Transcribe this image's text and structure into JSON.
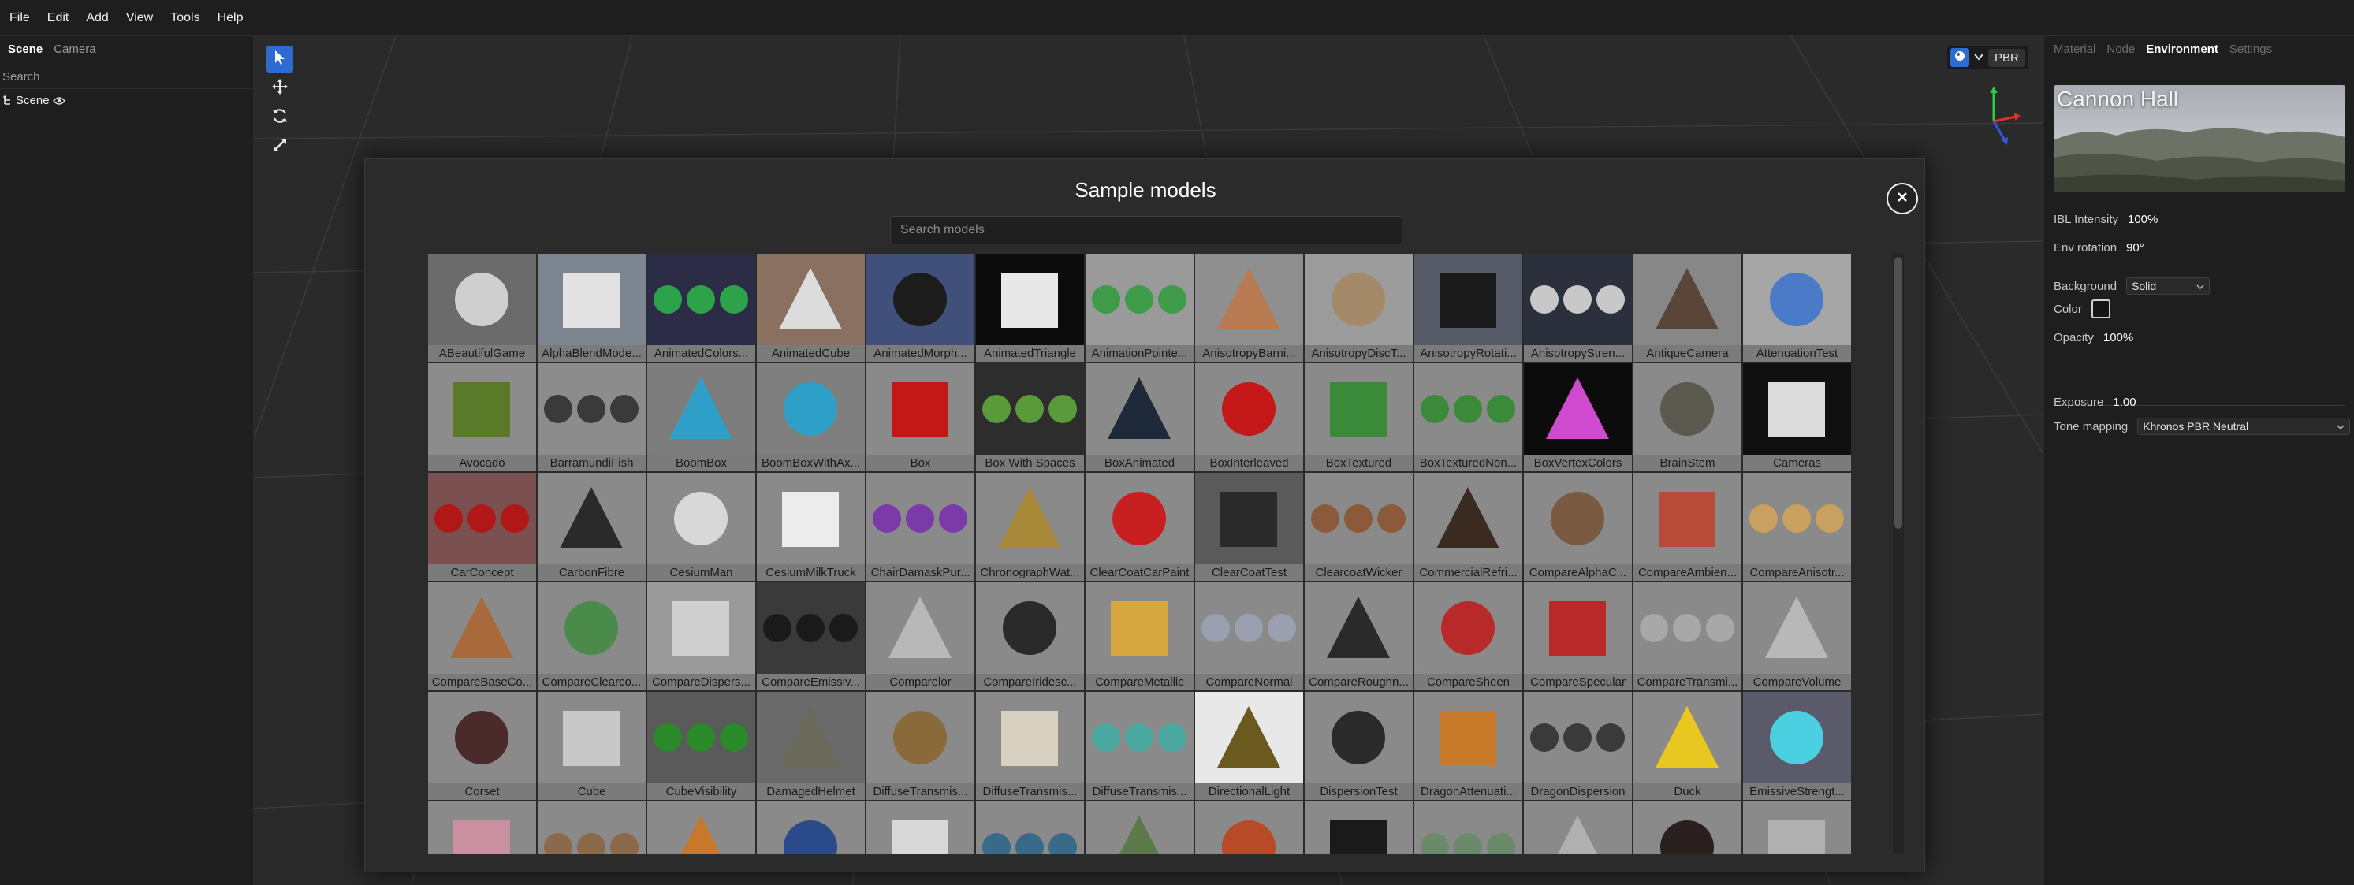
{
  "menu": [
    "File",
    "Edit",
    "Add",
    "View",
    "Tools",
    "Help"
  ],
  "left_panel": {
    "tabs": [
      "Scene",
      "Camera"
    ],
    "search_placeholder": "Search",
    "tree_item": "Scene"
  },
  "viewport": {
    "shading_mode": "PBR"
  },
  "modal": {
    "title": "Sample models",
    "search_placeholder": "Search models",
    "models": [
      {
        "name": "ABeautifulGame",
        "bg": "#6b6b6b",
        "fg": "#cfcfcf"
      },
      {
        "name": "AlphaBlendMode...",
        "bg": "#7c8590",
        "fg": "#e2e2e2"
      },
      {
        "name": "AnimatedColors...",
        "bg": "#2c2c46",
        "fg": "#2ca24a"
      },
      {
        "name": "AnimatedCube",
        "bg": "#8a7060",
        "fg": "#dcdcdc"
      },
      {
        "name": "AnimatedMorph...",
        "bg": "#40507a",
        "fg": "#1c1c1c"
      },
      {
        "name": "AnimatedTriangle",
        "bg": "#0c0c0c",
        "fg": "#e8e8e8"
      },
      {
        "name": "AnimationPointe...",
        "bg": "#9a9a9a",
        "fg": "#3d9b4a"
      },
      {
        "name": "AnisotropyBarni...",
        "bg": "#8f8f8f",
        "fg": "#b87a50"
      },
      {
        "name": "AnisotropyDiscT...",
        "bg": "#9c9c9c",
        "fg": "#a58a6a"
      },
      {
        "name": "AnisotropyRotati...",
        "bg": "#555a66",
        "fg": "#1a1a1a"
      },
      {
        "name": "AnisotropyStren...",
        "bg": "#2c2f3c",
        "fg": "#c8c8c8"
      },
      {
        "name": "AntiqueCamera",
        "bg": "#878787",
        "fg": "#5a4638"
      },
      {
        "name": "AttenuationTest",
        "bg": "#a6a6a6",
        "fg": "#4a7ac8"
      },
      {
        "name": "Avocado",
        "bg": "#8c8c8c",
        "fg": "#5a7a2a"
      },
      {
        "name": "BarramundiFish",
        "bg": "#8c8c8c",
        "fg": "#3a3a3a"
      },
      {
        "name": "BoomBox",
        "bg": "#7d7d7d",
        "fg": "#2ea0c8"
      },
      {
        "name": "BoomBoxWithAx...",
        "bg": "#7f7f7f",
        "fg": "#2ea0c8"
      },
      {
        "name": "Box",
        "bg": "#8a8a8a",
        "fg": "#c41818"
      },
      {
        "name": "Box With Spaces",
        "bg": "#2d2d2d",
        "fg": "#5a9a3a"
      },
      {
        "name": "BoxAnimated",
        "bg": "#8a8a8a",
        "fg": "#1e2a3a"
      },
      {
        "name": "BoxInterleaved",
        "bg": "#8a8a8a",
        "fg": "#c41818"
      },
      {
        "name": "BoxTextured",
        "bg": "#8a8a8a",
        "fg": "#3a8a3a"
      },
      {
        "name": "BoxTexturedNon...",
        "bg": "#8a8a8a",
        "fg": "#3a8a3a"
      },
      {
        "name": "BoxVertexColors",
        "bg": "#0c0c0c",
        "fg": "#d04ad0"
      },
      {
        "name": "BrainStem",
        "bg": "#8a8a8a",
        "fg": "#5a5a50"
      },
      {
        "name": "Cameras",
        "bg": "#101010",
        "fg": "#dcdcdc"
      },
      {
        "name": "CarConcept",
        "bg": "#7a5050",
        "fg": "#b01818"
      },
      {
        "name": "CarbonFibre",
        "bg": "#8a8a8a",
        "fg": "#2a2a2a"
      },
      {
        "name": "CesiumMan",
        "bg": "#8a8a8a",
        "fg": "#d8d8d8"
      },
      {
        "name": "CesiumMilkTruck",
        "bg": "#8a8a8a",
        "fg": "#ececec"
      },
      {
        "name": "ChairDamaskPur...",
        "bg": "#8a8a8a",
        "fg": "#7a3aa8"
      },
      {
        "name": "ChronographWat...",
        "bg": "#8a8a8a",
        "fg": "#a88a3a"
      },
      {
        "name": "ClearCoatCarPaint",
        "bg": "#8a8a8a",
        "fg": "#c82020"
      },
      {
        "name": "ClearCoatTest",
        "bg": "#5a5a5a",
        "fg": "#2a2a2a"
      },
      {
        "name": "ClearcoatWicker",
        "bg": "#8a8a8a",
        "fg": "#8a5a3a"
      },
      {
        "name": "CommercialRefri...",
        "bg": "#8a8a8a",
        "fg": "#3a2a20"
      },
      {
        "name": "CompareAlphaC...",
        "bg": "#8a8a8a",
        "fg": "#7a5a40"
      },
      {
        "name": "CompareAmbien...",
        "bg": "#8a8a8a",
        "fg": "#b84a3a"
      },
      {
        "name": "CompareAnisotr...",
        "bg": "#8a8a8a",
        "fg": "#c8a060"
      },
      {
        "name": "CompareBaseCo...",
        "bg": "#8a8a8a",
        "fg": "#a86a3a"
      },
      {
        "name": "CompareClearco...",
        "bg": "#8a8a8a",
        "fg": "#4a8a4a"
      },
      {
        "name": "CompareDispers...",
        "bg": "#9a9a9a",
        "fg": "#cfcfcf"
      },
      {
        "name": "CompareEmissiv...",
        "bg": "#3a3a3a",
        "fg": "#1a1a1a"
      },
      {
        "name": "Comparelor",
        "bg": "#8a8a8a",
        "fg": "#b8b8b8"
      },
      {
        "name": "CompareIridesc...",
        "bg": "#8a8a8a",
        "fg": "#2a2a2a"
      },
      {
        "name": "CompareMetallic",
        "bg": "#8a8a8a",
        "fg": "#d8a840"
      },
      {
        "name": "CompareNormal",
        "bg": "#8a8a8a",
        "fg": "#9aa0b0"
      },
      {
        "name": "CompareRoughn...",
        "bg": "#8a8a8a",
        "fg": "#2a2a2a"
      },
      {
        "name": "CompareSheen",
        "bg": "#8a8a8a",
        "fg": "#b82a2a"
      },
      {
        "name": "CompareSpecular",
        "bg": "#8a8a8a",
        "fg": "#b82a2a"
      },
      {
        "name": "CompareTransmi...",
        "bg": "#8a8a8a",
        "fg": "#a8a8a8"
      },
      {
        "name": "CompareVolume",
        "bg": "#8a8a8a",
        "fg": "#b8b8b8"
      },
      {
        "name": "Corset",
        "bg": "#8a8a8a",
        "fg": "#4a2a2a"
      },
      {
        "name": "Cube",
        "bg": "#8a8a8a",
        "fg": "#c8c8c8"
      },
      {
        "name": "CubeVisibility",
        "bg": "#5a5a5a",
        "fg": "#2a8a2a"
      },
      {
        "name": "DamagedHelmet",
        "bg": "#6a6a6a",
        "fg": "#6a6a5a"
      },
      {
        "name": "DiffuseTransmis...",
        "bg": "#8a8a8a",
        "fg": "#8a6a3a"
      },
      {
        "name": "DiffuseTransmis...",
        "bg": "#8a8a8a",
        "fg": "#d8d0c0"
      },
      {
        "name": "DiffuseTransmis...",
        "bg": "#8a8a8a",
        "fg": "#4aa8a0"
      },
      {
        "name": "DirectionalLight",
        "bg": "#e8e8e8",
        "fg": "#6a5a20"
      },
      {
        "name": "DispersionTest",
        "bg": "#8a8a8a",
        "fg": "#2a2a2a"
      },
      {
        "name": "DragonAttenuati...",
        "bg": "#8a8a8a",
        "fg": "#c87a2a"
      },
      {
        "name": "DragonDispersion",
        "bg": "#8a8a8a",
        "fg": "#3a3a3a"
      },
      {
        "name": "Duck",
        "bg": "#8a8a8a",
        "fg": "#e8c820"
      },
      {
        "name": "EmissiveStrengt...",
        "bg": "#5a5a6a",
        "fg": "#4ad0e0"
      },
      {
        "name": "",
        "bg": "#8a8a8a",
        "fg": "#c890a0"
      },
      {
        "name": "",
        "bg": "#8a8a8a",
        "fg": "#8a6a4a"
      },
      {
        "name": "",
        "bg": "#8a8a8a",
        "fg": "#c8782a"
      },
      {
        "name": "",
        "bg": "#8a8a8a",
        "fg": "#2a4a8a"
      },
      {
        "name": "",
        "bg": "#8a8a8a",
        "fg": "#d8d8d8"
      },
      {
        "name": "",
        "bg": "#8a8a8a",
        "fg": "#3a6a8a"
      },
      {
        "name": "",
        "bg": "#8a8a8a",
        "fg": "#5a7a4a"
      },
      {
        "name": "",
        "bg": "#8a8a8a",
        "fg": "#b84a2a"
      },
      {
        "name": "",
        "bg": "#8a8a8a",
        "fg": "#1a1a1a"
      },
      {
        "name": "",
        "bg": "#8a8a8a",
        "fg": "#6a8a6a"
      },
      {
        "name": "",
        "bg": "#8a8a8a",
        "fg": "#b0b0b0"
      },
      {
        "name": "",
        "bg": "#8a8a8a",
        "fg": "#2a2020"
      },
      {
        "name": "",
        "bg": "#8a8a8a",
        "fg": "#b0b0b0"
      }
    ]
  },
  "right_panel": {
    "tabs": [
      "Material",
      "Node",
      "Environment",
      "Settings"
    ],
    "active_tab": "Environment",
    "env_name": "Cannon Hall",
    "ibl_label": "IBL Intensity",
    "ibl_value": "100%",
    "env_rotation_label": "Env rotation",
    "env_rotation_value": "90°",
    "background_label": "Background",
    "background_value": "Solid",
    "color_label": "Color",
    "opacity_label": "Opacity",
    "opacity_value": "100%",
    "exposure_label": "Exposure",
    "exposure_value": "1.00",
    "tone_mapping_label": "Tone mapping",
    "tone_mapping_value": "Khronos PBR Neutral"
  },
  "colors": {
    "accent": "#2f6ad0",
    "panel": "#1e1e1e",
    "modal": "#2b2b2b"
  }
}
